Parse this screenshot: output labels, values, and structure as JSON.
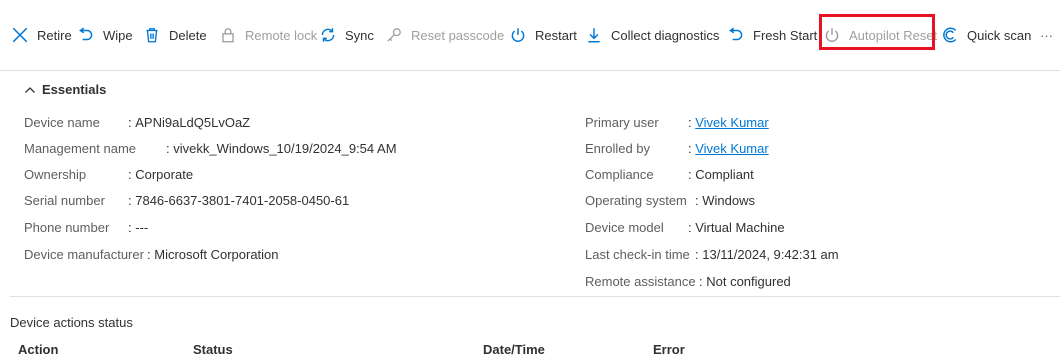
{
  "toolbar": {
    "retire": "Retire",
    "wipe": "Wipe",
    "delete": "Delete",
    "remote_lock": "Remote lock",
    "sync": "Sync",
    "reset_passcode": "Reset passcode",
    "restart": "Restart",
    "collect_diagnostics": "Collect diagnostics",
    "fresh_start": "Fresh Start",
    "autopilot_reset": "Autopilot Reset",
    "quick_scan": "Quick scan",
    "more": "···"
  },
  "essentials": {
    "title": "Essentials",
    "left": [
      {
        "label": "Device name",
        "value": "APNi9aLdQ5LvOaZ"
      },
      {
        "label": "Management name",
        "value": "vivekk_Windows_10/19/2024_9:54 AM"
      },
      {
        "label": "Ownership",
        "value": "Corporate"
      },
      {
        "label": "Serial number",
        "value": "7846-6637-3801-7401-2058-0450-61"
      },
      {
        "label": "Phone number",
        "value": "---"
      },
      {
        "label": "Device manufacturer",
        "value": "Microsoft Corporation"
      }
    ],
    "right": [
      {
        "label": "Primary user",
        "value": "Vivek Kumar"
      },
      {
        "label": "Enrolled by",
        "value": "Vivek Kumar"
      },
      {
        "label": "Compliance",
        "value": "Compliant"
      },
      {
        "label": "Operating system",
        "value": "Windows"
      },
      {
        "label": "Device model",
        "value": "Virtual Machine"
      },
      {
        "label": "Last check-in time",
        "value": "13/11/2024, 9:42:31 am"
      },
      {
        "label": "Remote assistance",
        "value": "Not configured"
      }
    ]
  },
  "actions_status": {
    "title": "Device actions status",
    "columns": [
      "Action",
      "Status",
      "Date/Time",
      "Error"
    ]
  },
  "colors": {
    "accent": "#0078d4",
    "highlight": "#e81123",
    "disabled": "#a19f9d"
  }
}
